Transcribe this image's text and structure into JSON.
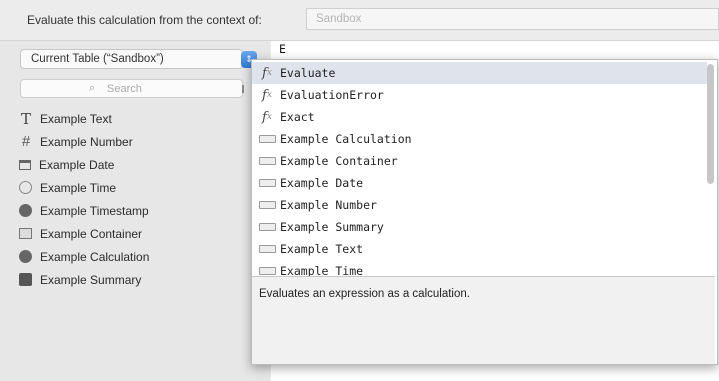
{
  "context_bar": {
    "label": "Evaluate this calculation from the context of:",
    "context_value": "Sandbox"
  },
  "sidebar": {
    "scope_select": "Current Table (“Sandbox”)",
    "search_placeholder": "Search",
    "fields": [
      {
        "label": "Example Text",
        "icon": "text-type-icon"
      },
      {
        "label": "Example Number",
        "icon": "number-type-icon"
      },
      {
        "label": "Example Date",
        "icon": "date-type-icon"
      },
      {
        "label": "Example Time",
        "icon": "time-type-icon"
      },
      {
        "label": "Example Timestamp",
        "icon": "timestamp-type-icon"
      },
      {
        "label": "Example Container",
        "icon": "container-type-icon"
      },
      {
        "label": "Example Calculation",
        "icon": "calculation-type-icon"
      },
      {
        "label": "Example Summary",
        "icon": "summary-type-icon"
      }
    ]
  },
  "editor": {
    "text": "E"
  },
  "autocomplete": {
    "items": [
      {
        "label": "Evaluate",
        "kind": "function",
        "selected": true
      },
      {
        "label": "EvaluationError",
        "kind": "function",
        "selected": false
      },
      {
        "label": "Exact",
        "kind": "function",
        "selected": false
      },
      {
        "label": "Example Calculation",
        "kind": "field",
        "selected": false
      },
      {
        "label": "Example Container",
        "kind": "field",
        "selected": false
      },
      {
        "label": "Example Date",
        "kind": "field",
        "selected": false
      },
      {
        "label": "Example Number",
        "kind": "field",
        "selected": false
      },
      {
        "label": "Example Summary",
        "kind": "field",
        "selected": false
      },
      {
        "label": "Example Text",
        "kind": "field",
        "selected": false
      },
      {
        "label": "Example Time",
        "kind": "field",
        "selected": false
      }
    ],
    "description": "Evaluates an expression as a calculation."
  },
  "icons": {
    "function_glyph": "fx",
    "search_glyph": "⌕",
    "select_glyph": "⇕"
  }
}
